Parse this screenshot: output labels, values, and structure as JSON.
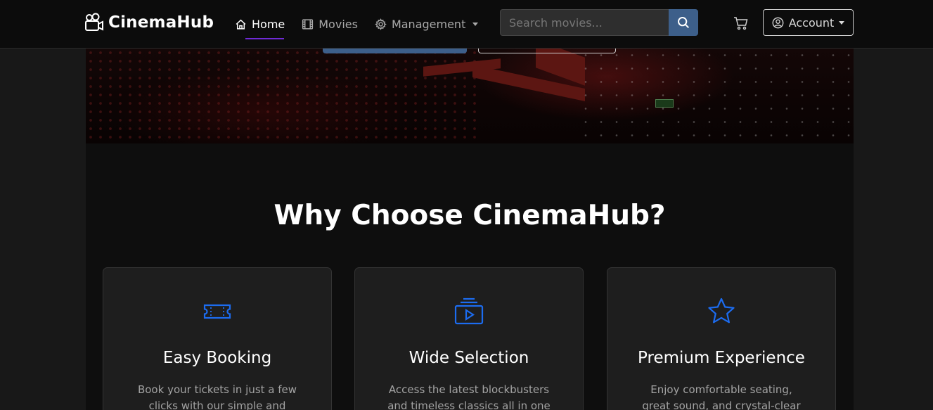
{
  "colors": {
    "accent_purple": "#6f2bd6",
    "primary_blue": "#3d5f8a",
    "icon_blue": "#1c6cf0",
    "navbar_bg": "#0c0c0c",
    "page_bg": "#181818",
    "card_bg": "#1e1e1e"
  },
  "navbar": {
    "brand": {
      "text": "CinemaHub",
      "icon": "film-camera-icon"
    },
    "links": [
      {
        "label": "Home",
        "icon": "house-icon",
        "active": true
      },
      {
        "label": "Movies",
        "icon": "film-icon",
        "active": false
      },
      {
        "label": "Management",
        "icon": "gear-icon",
        "active": false,
        "dropdown": true
      }
    ],
    "search": {
      "placeholder": "Search movies...",
      "value": "",
      "button_icon": "search-icon"
    },
    "cart_icon": "cart-icon",
    "account": {
      "label": "Account",
      "icon": "user-circle-icon",
      "dropdown": true
    }
  },
  "hero": {
    "image": "cinema-auditorium-photo"
  },
  "features": {
    "title": "Why Choose CinemaHub?",
    "cards": [
      {
        "icon": "ticket-icon",
        "title": "Easy Booking",
        "text": "Book your tickets in just a few clicks with our simple and"
      },
      {
        "icon": "collection-play-icon",
        "title": "Wide Selection",
        "text": "Access the latest blockbusters and timeless classics all in one"
      },
      {
        "icon": "star-icon",
        "title": "Premium Experience",
        "text": "Enjoy comfortable seating, great sound, and crystal-clear"
      }
    ]
  }
}
